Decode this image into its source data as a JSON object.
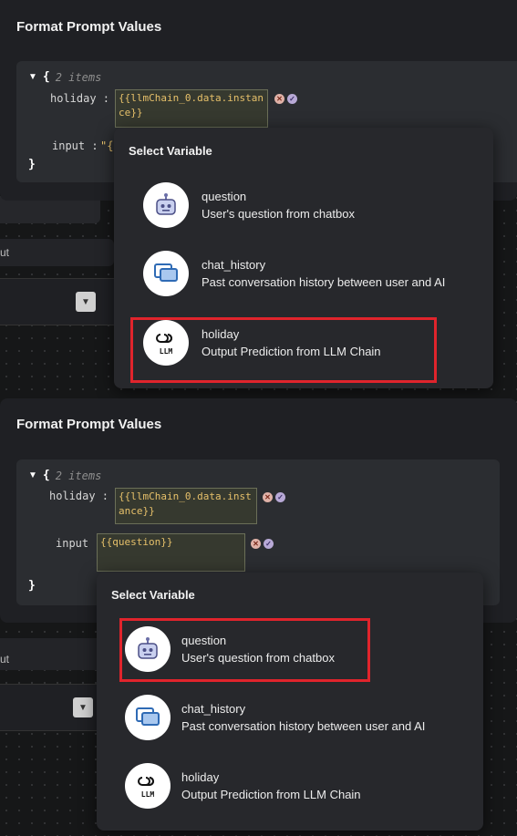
{
  "bg": {
    "side_label_1": "ut",
    "side_label_2": "ut"
  },
  "panel1": {
    "title": "Format Prompt Values",
    "open_brace": "{",
    "count": "2 items",
    "key1": "holiday :",
    "value1": "{{llmChain_0.data.instance}}",
    "key2": "input :",
    "value2_partial": "\"{",
    "close_brace": "}"
  },
  "popup1": {
    "title": "Select Variable",
    "items": [
      {
        "name": "question",
        "desc": "User's question from chatbox",
        "icon": "robot-icon"
      },
      {
        "name": "chat_history",
        "desc": "Past conversation history between user and AI",
        "icon": "chat-bubbles-icon"
      },
      {
        "name": "holiday",
        "desc": "Output Prediction from LLM Chain",
        "icon": "llm-chain-icon",
        "icon_text": "LLM"
      }
    ]
  },
  "panel2": {
    "title": "Format Prompt Values",
    "open_brace": "{",
    "count": "2 items",
    "key1": "holiday :",
    "value1": "{{llmChain_0.data.instance}}",
    "key2": "input :",
    "value2": "{{question}}",
    "close_brace": "}"
  },
  "popup2": {
    "title": "Select Variable",
    "items": [
      {
        "name": "question",
        "desc": "User's question from chatbox",
        "icon": "robot-icon"
      },
      {
        "name": "chat_history",
        "desc": "Past conversation history between user and AI",
        "icon": "chat-bubbles-icon"
      },
      {
        "name": "holiday",
        "desc": "Output Prediction from LLM Chain",
        "icon": "llm-chain-icon",
        "icon_text": "LLM"
      }
    ]
  },
  "colors": {
    "highlight": "#e0242c",
    "panel_bg": "#1f2024",
    "popup_bg": "#27282c",
    "value_text": "#e6c06a"
  }
}
